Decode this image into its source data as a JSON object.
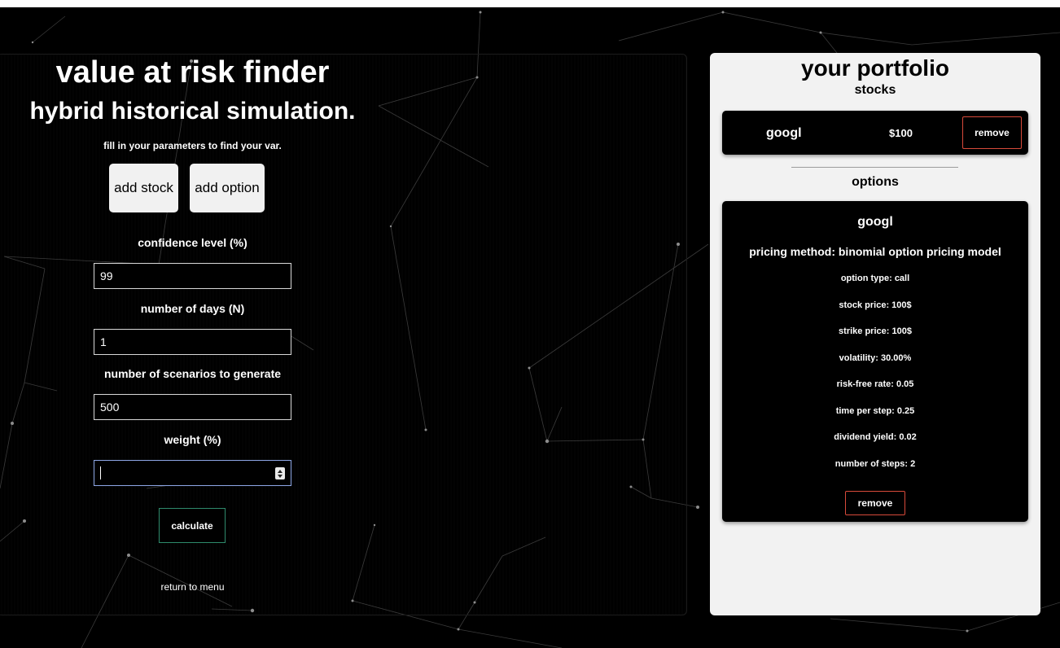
{
  "calculator": {
    "title": "value at risk finder",
    "subtitle": "hybrid historical simulation.",
    "hint": "fill in your parameters to find your var.",
    "add_stock_label": "add stock",
    "add_option_label": "add option",
    "fields": [
      {
        "label": "confidence level (%)",
        "value": "99"
      },
      {
        "label": "number of days (N)",
        "value": "1"
      },
      {
        "label": "number of scenarios to generate",
        "value": "500"
      },
      {
        "label": "weight (%)",
        "value": ""
      }
    ],
    "calculate_label": "calculate",
    "return_label": "return to menu"
  },
  "portfolio": {
    "title": "your portfolio",
    "stocks_heading": "stocks",
    "options_heading": "options",
    "stocks": [
      {
        "name": "googl",
        "price": "$100",
        "remove_label": "remove"
      }
    ],
    "options": [
      {
        "name": "googl",
        "method": "pricing method: binomial option pricing model",
        "details": [
          "option type: call",
          "stock price: 100$",
          "strike price: 100$",
          "volatility: 30.00%",
          "risk-free rate: 0.05",
          "time per step: 0.25",
          "dividend yield: 0.02",
          "number of steps: 2"
        ],
        "remove_label": "remove"
      }
    ]
  },
  "colors": {
    "background": "#000000",
    "panel": "#f2f2f2",
    "calculate_border": "#2e8a6c",
    "remove_border": "#d84a3a",
    "active_field_border": "#8ea7e6"
  }
}
